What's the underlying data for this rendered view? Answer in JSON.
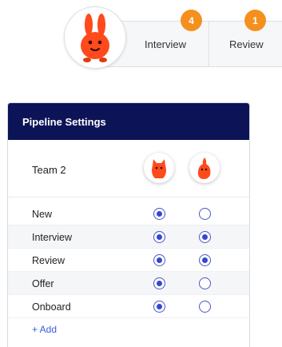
{
  "tabs": [
    {
      "label": "Interview",
      "badge": "4"
    },
    {
      "label": "Review",
      "badge": "1"
    }
  ],
  "colors": {
    "badge": "#f5901f",
    "header_bg": "#0c1457",
    "radio": "#3347d6",
    "mascot": "#ff4a1c",
    "link": "#3b5bdb"
  },
  "pipeline": {
    "title": "Pipeline Settings",
    "team_label": "Team 2",
    "add_label": "+ Add",
    "stages": [
      {
        "label": "New",
        "col1": true,
        "col2": false
      },
      {
        "label": "Interview",
        "col1": true,
        "col2": true
      },
      {
        "label": "Review",
        "col1": true,
        "col2": true
      },
      {
        "label": "Offer",
        "col1": true,
        "col2": false
      },
      {
        "label": "Onboard",
        "col1": true,
        "col2": false
      }
    ]
  }
}
